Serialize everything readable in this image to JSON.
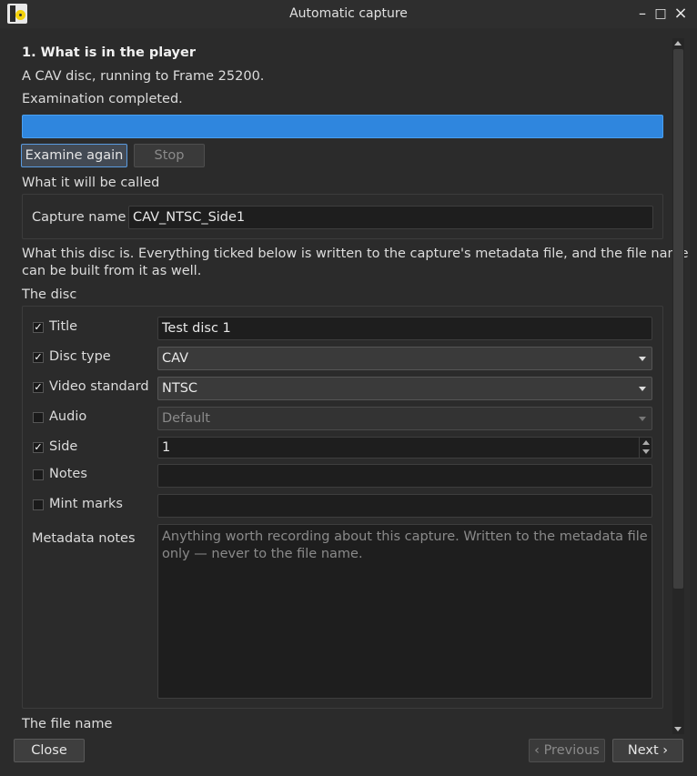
{
  "window": {
    "title": "Automatic capture"
  },
  "section1": {
    "heading": "1. What is in the player",
    "player_status": "A CAV disc, running to Frame 25200.",
    "exam_status": "Examination completed.",
    "progress": 1.0,
    "examine_again": "Examine again",
    "stop": "Stop"
  },
  "naming": {
    "label": "What it will be called",
    "capture_name_label": "Capture name",
    "capture_name_value": "CAV_NTSC_Side1"
  },
  "disc_info": {
    "description_line1": "What this disc is. Everything ticked below is written to the capture's metadata file, and the file name",
    "description_line2": "can be built from it as well.",
    "group_label": "The disc"
  },
  "fields": {
    "title": {
      "label": "Title",
      "checked": true,
      "value": "Test disc 1"
    },
    "disc_type": {
      "label": "Disc type",
      "checked": true,
      "value": "CAV"
    },
    "video_standard": {
      "label": "Video standard",
      "checked": true,
      "value": "NTSC"
    },
    "audio": {
      "label": "Audio",
      "checked": false,
      "value": "Default"
    },
    "side": {
      "label": "Side",
      "checked": true,
      "value": "1"
    },
    "notes": {
      "label": "Notes",
      "checked": false,
      "value": ""
    },
    "mint_marks": {
      "label": "Mint marks",
      "checked": false,
      "value": ""
    },
    "metadata_notes": {
      "label": "Metadata notes",
      "placeholder": "Anything worth recording about this capture. Written to the metadata file only — never to the file name."
    }
  },
  "file_name": {
    "label": "The file name"
  },
  "footer": {
    "close": "Close",
    "previous": "‹ Previous",
    "next": "Next ›"
  },
  "colors": {
    "progress": "#2f86de",
    "background": "#2b2b2b"
  }
}
